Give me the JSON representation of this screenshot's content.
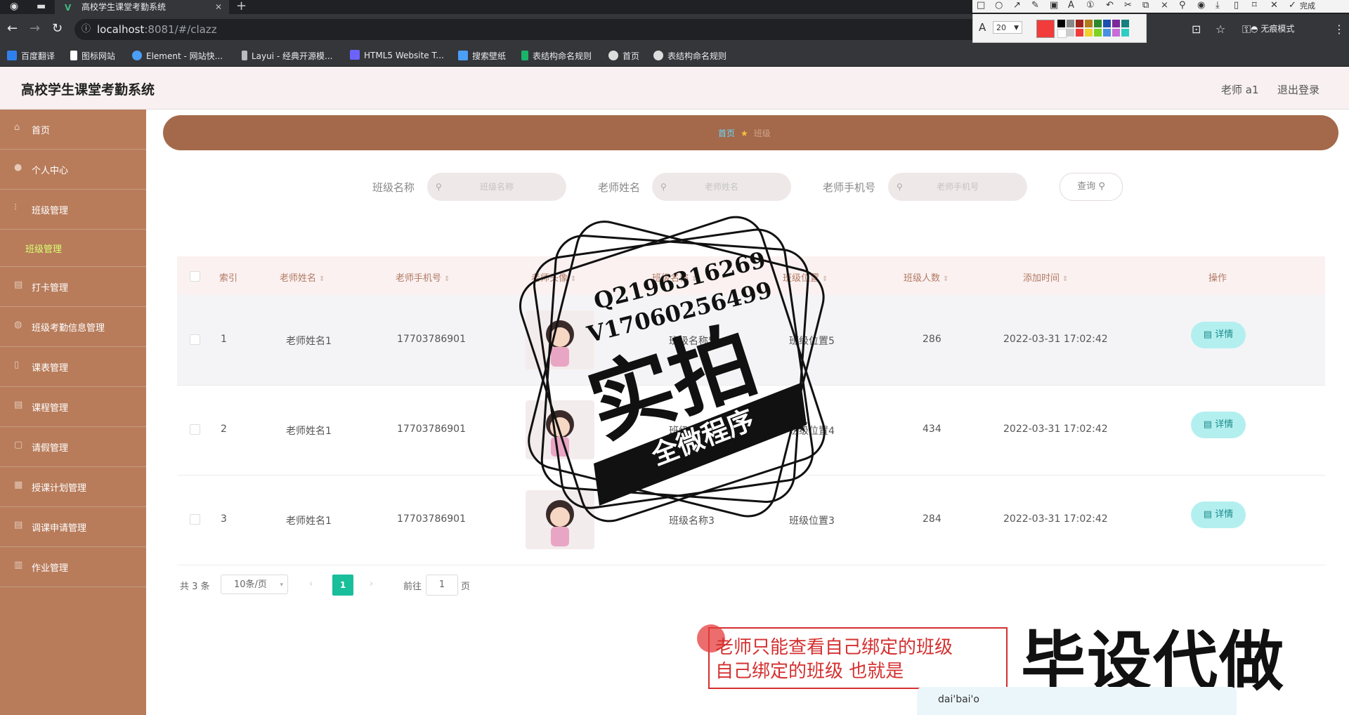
{
  "browser": {
    "tab_title": "高校学生课堂考勤系统",
    "tab_close": "✕",
    "new_tab": "+",
    "url_host": "localhost",
    "url_rest": ":8081/#/clazz",
    "incognito_label": "无痕模式",
    "bookmarks": [
      {
        "label": "百度翻译",
        "color": "#2f80ed"
      },
      {
        "label": "图标网站",
        "color": "#ffffff"
      },
      {
        "label": "Element - 网站快...",
        "color": "#4b9ff5"
      },
      {
        "label": "Layui - 经典开源模...",
        "color": "#bbbbbb"
      },
      {
        "label": "HTML5 Website T...",
        "color": "#6c63ff"
      },
      {
        "label": "搜索壁纸",
        "color": "#4b9ff5"
      },
      {
        "label": "表结构命名规则",
        "color": "#1bb36a"
      },
      {
        "label": "首页",
        "color": "#dddddd"
      },
      {
        "label": "表结构命名规则",
        "color": "#dddddd"
      }
    ],
    "annotation_font_size": "20",
    "annotation_done": "完成"
  },
  "app": {
    "title": "高校学生课堂考勤系统",
    "user_label": "老师 a1",
    "logout_label": "退出登录"
  },
  "sidebar": {
    "items": [
      {
        "label": "首页",
        "icon": "home-icon"
      },
      {
        "label": "个人中心",
        "icon": "user-icon"
      },
      {
        "label": "班级管理",
        "icon": "class-icon"
      },
      {
        "label": "打卡管理",
        "icon": "clock-icon"
      },
      {
        "label": "班级考勤信息管理",
        "icon": "attendance-icon"
      },
      {
        "label": "课表管理",
        "icon": "schedule-icon"
      },
      {
        "label": "课程管理",
        "icon": "course-icon"
      },
      {
        "label": "请假管理",
        "icon": "leave-icon"
      },
      {
        "label": "授课计划管理",
        "icon": "plan-icon"
      },
      {
        "label": "调课申请管理",
        "icon": "adjust-icon"
      },
      {
        "label": "作业管理",
        "icon": "homework-icon"
      }
    ],
    "submenu_label": "班级管理"
  },
  "breadcrumb": {
    "home": "首页",
    "current": "班级"
  },
  "search": {
    "class_name_label": "班级名称",
    "class_name_placeholder": "班级名称",
    "teacher_name_label": "老师姓名",
    "teacher_name_placeholder": "老师姓名",
    "teacher_phone_label": "老师手机号",
    "teacher_phone_placeholder": "老师手机号",
    "query_button": "查询"
  },
  "table": {
    "columns": [
      "索引",
      "老师姓名",
      "老师手机号",
      "老师头像",
      "班级名称",
      "班级位置",
      "班级人数",
      "添加时间",
      "操作"
    ],
    "rows": [
      {
        "index": "1",
        "teacher_name": "老师姓名1",
        "teacher_phone": "17703786901",
        "class_name": "班级名称5",
        "class_location": "班级位置5",
        "count": "286",
        "time": "2022-03-31 17:02:42"
      },
      {
        "index": "2",
        "teacher_name": "老师姓名1",
        "teacher_phone": "17703786901",
        "class_name": "班级名称4",
        "class_location": "班级位置4",
        "count": "434",
        "time": "2022-03-31 17:02:42"
      },
      {
        "index": "3",
        "teacher_name": "老师姓名1",
        "teacher_phone": "17703786901",
        "class_name": "班级名称3",
        "class_location": "班级位置3",
        "count": "284",
        "time": "2022-03-31 17:02:42"
      }
    ],
    "detail_button": "详情"
  },
  "pagination": {
    "total": "共 3 条",
    "page_size": "10条/页",
    "current_page": "1",
    "goto_label": "前往",
    "goto_value": "1",
    "page_suffix": "页"
  },
  "overlay": {
    "watermark_contact_1": "Q2196316269",
    "watermark_contact_2": "V17060256499",
    "watermark_big": "实拍",
    "watermark_banner": "全微程序",
    "subtitle_line1": "老师只能查看自己绑定的班级",
    "subtitle_line2": "自己绑定的班级 也就是",
    "ime_text": "dai'bai'o",
    "promo_text": "毕设代做"
  }
}
